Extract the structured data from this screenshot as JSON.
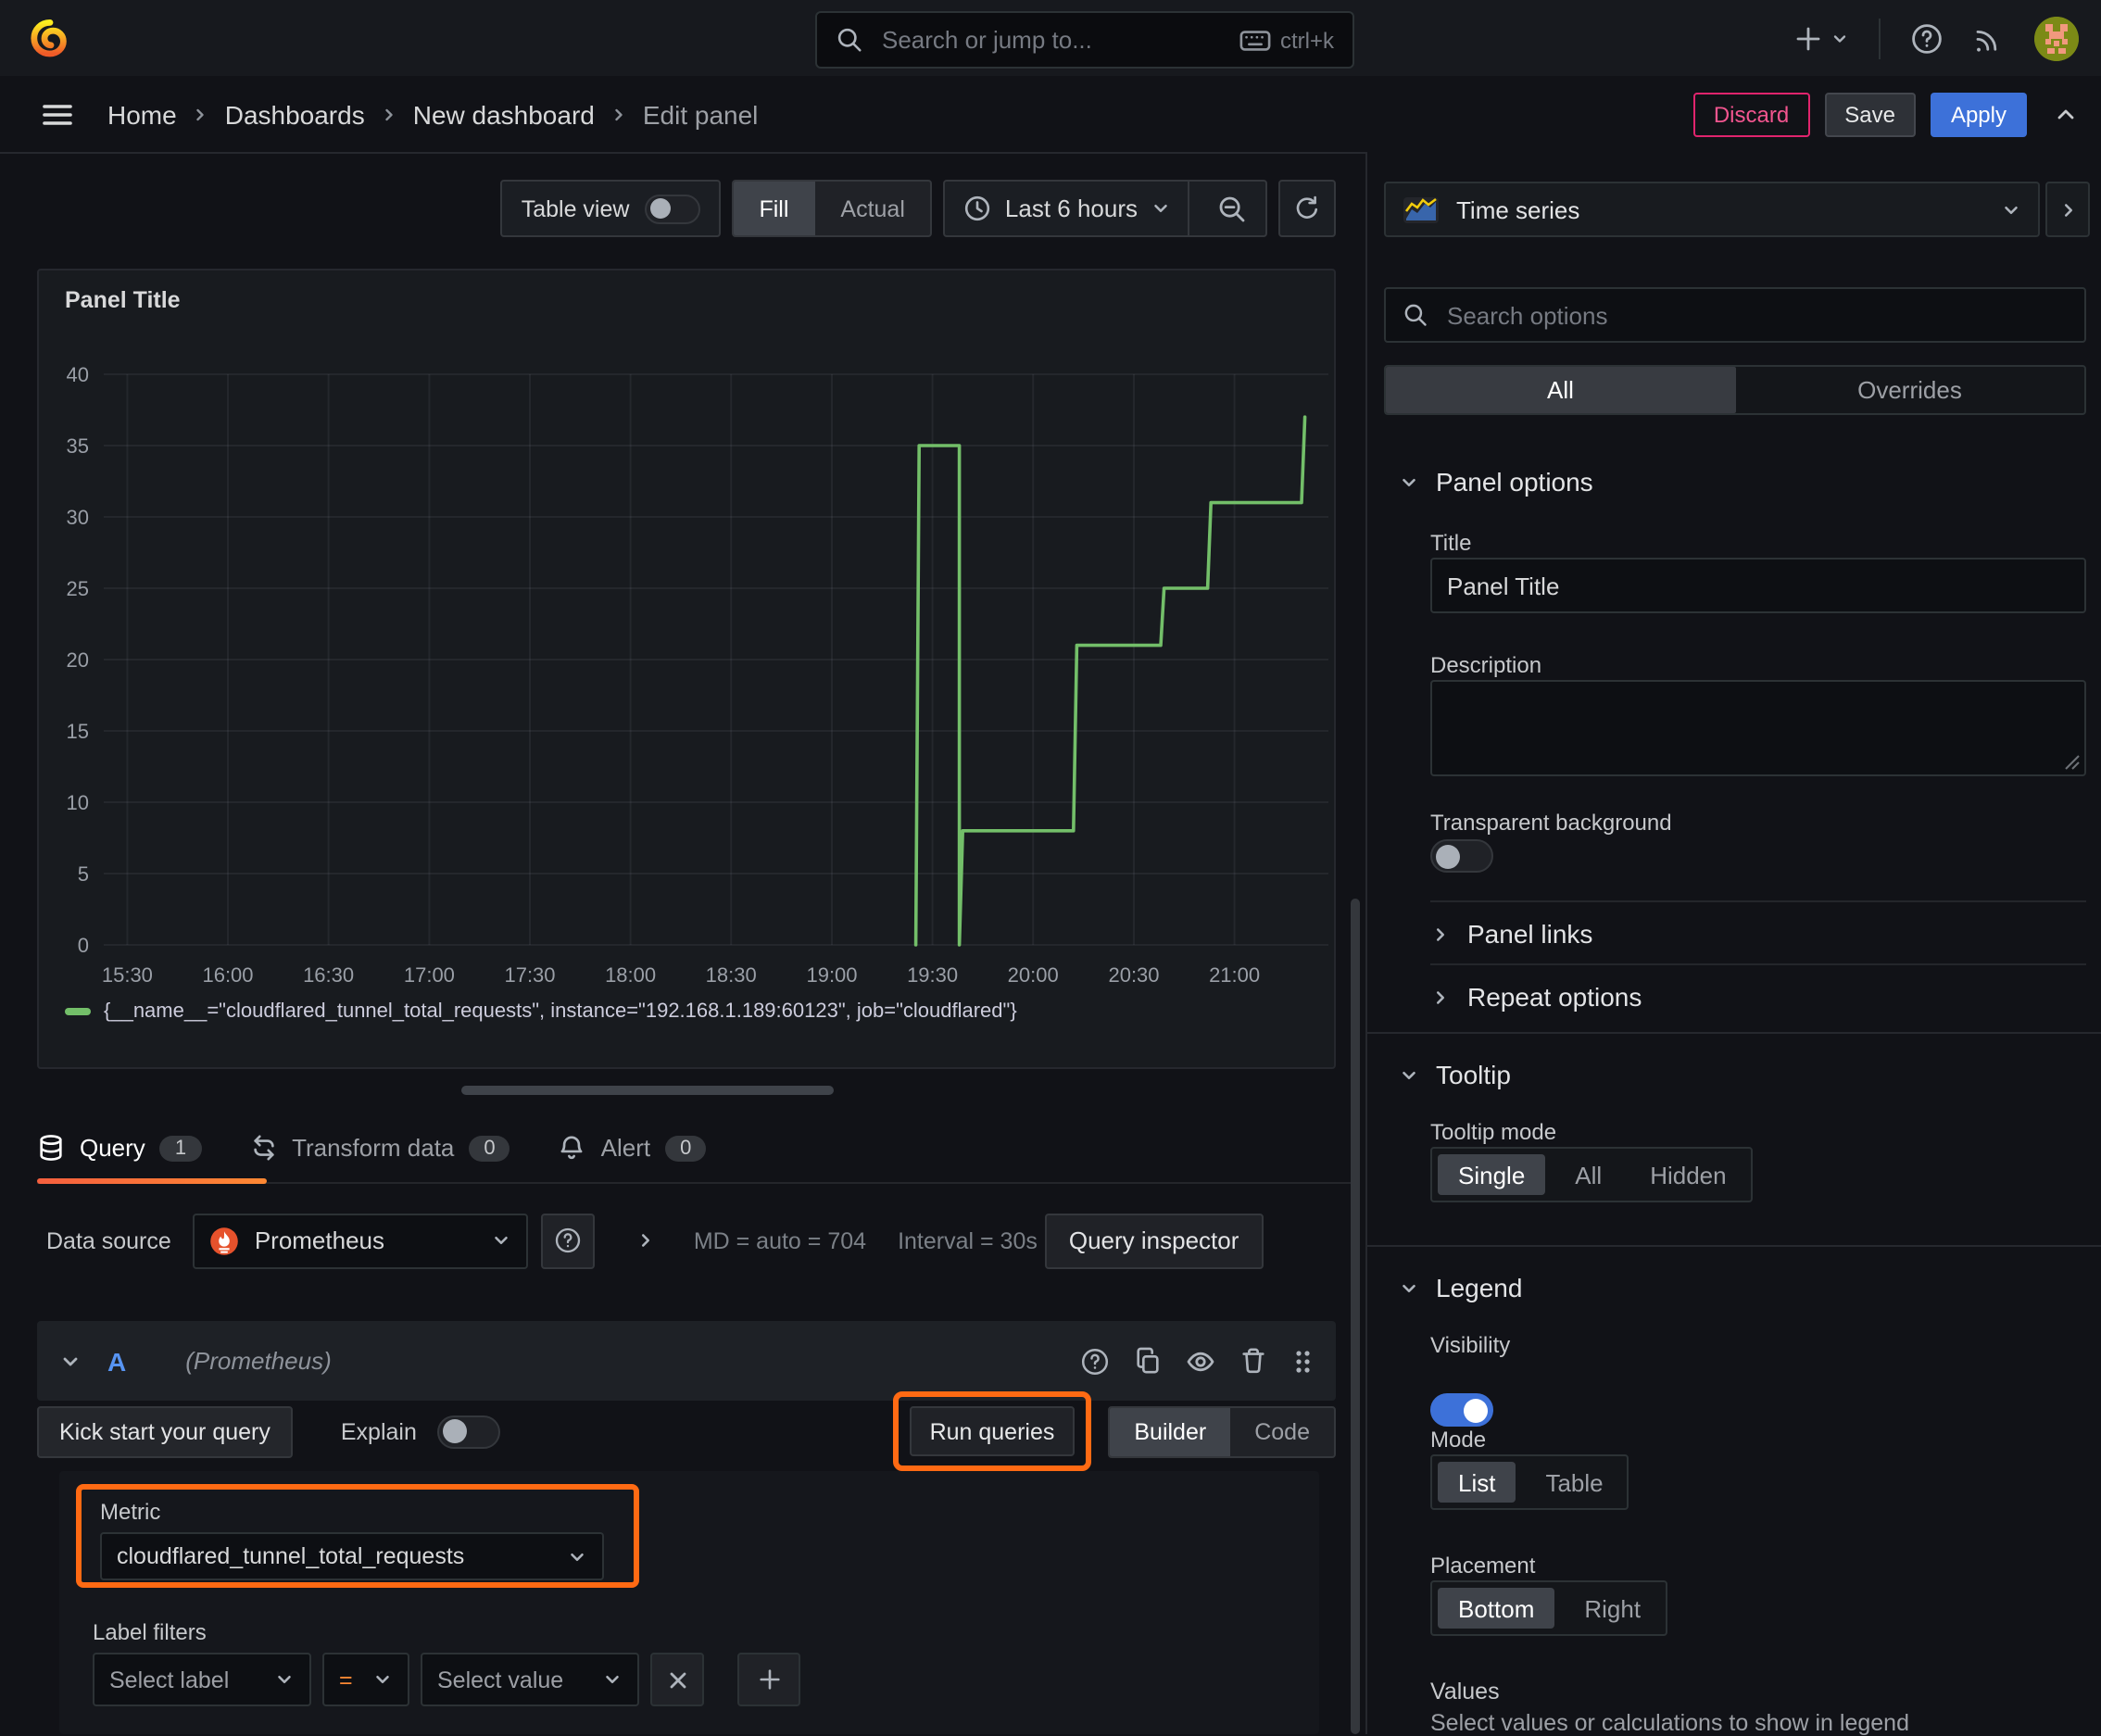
{
  "topnav": {
    "search_placeholder": "Search or jump to...",
    "search_shortcut": "ctrl+k"
  },
  "breadcrumbs": [
    "Home",
    "Dashboards",
    "New dashboard",
    "Edit panel"
  ],
  "actions": {
    "discard": "Discard",
    "save": "Save",
    "apply": "Apply"
  },
  "panel_toolbar": {
    "table_view_label": "Table view",
    "fill_label": "Fill",
    "actual_label": "Actual",
    "time_range_label": "Last 6 hours"
  },
  "panel": {
    "title": "Panel Title"
  },
  "chart_data": {
    "type": "line",
    "title": "Panel Title",
    "xlabel": "",
    "ylabel": "",
    "x_ticks": [
      "15:30",
      "16:00",
      "16:30",
      "17:00",
      "17:30",
      "18:00",
      "18:30",
      "19:00",
      "19:30",
      "20:00",
      "20:30",
      "21:00"
    ],
    "x_range": [
      "15:23",
      "21:28"
    ],
    "y_ticks": [
      0,
      5,
      10,
      15,
      20,
      25,
      30,
      35,
      40
    ],
    "ylim": [
      0,
      40
    ],
    "grid": true,
    "legend_position": "bottom",
    "series": [
      {
        "name": "{__name__=\"cloudflared_tunnel_total_requests\", instance=\"192.168.1.189:60123\", job=\"cloudflared\"}",
        "color": "#73BF69",
        "points": [
          [
            "19:25",
            0
          ],
          [
            "19:26",
            35
          ],
          [
            "19:38",
            35
          ],
          [
            "19:38",
            0
          ],
          [
            "19:39",
            8
          ],
          [
            "20:12",
            8
          ],
          [
            "20:13",
            21
          ],
          [
            "20:38",
            21
          ],
          [
            "20:39",
            25
          ],
          [
            "20:52",
            25
          ],
          [
            "20:53",
            31
          ],
          [
            "21:20",
            31
          ],
          [
            "21:21",
            37
          ]
        ]
      }
    ]
  },
  "query_section": {
    "tabs": [
      {
        "label": "Query",
        "count": "1"
      },
      {
        "label": "Transform data",
        "count": "0"
      },
      {
        "label": "Alert",
        "count": "0"
      }
    ],
    "datasource_label": "Data source",
    "datasource_value": "Prometheus",
    "stats_md": "MD = auto = 704",
    "stats_interval": "Interval = 30s",
    "query_inspector_label": "Query inspector",
    "row": {
      "ref_id": "A",
      "ds_note": "(Prometheus)"
    },
    "kick_start_label": "Kick start your query",
    "explain_label": "Explain",
    "run_queries_label": "Run queries",
    "builder_label": "Builder",
    "code_label": "Code",
    "metric_label": "Metric",
    "metric_value": "cloudflared_tunnel_total_requests",
    "label_filters_label": "Label filters",
    "select_label_placeholder": "Select label",
    "operator_value": "=",
    "select_value_placeholder": "Select value"
  },
  "sidebar": {
    "viz_type": "Time series",
    "search_placeholder": "Search options",
    "tab_all": "All",
    "tab_overrides": "Overrides",
    "panel_options": {
      "heading": "Panel options",
      "title_label": "Title",
      "title_value": "Panel Title",
      "description_label": "Description",
      "transparent_label": "Transparent background"
    },
    "panel_links_heading": "Panel links",
    "repeat_options_heading": "Repeat options",
    "tooltip": {
      "heading": "Tooltip",
      "mode_label": "Tooltip mode",
      "options": [
        "Single",
        "All",
        "Hidden"
      ],
      "selected": "Single"
    },
    "legend": {
      "heading": "Legend",
      "visibility_label": "Visibility",
      "mode_label": "Mode",
      "mode_options": [
        "List",
        "Table"
      ],
      "mode_selected": "List",
      "placement_label": "Placement",
      "placement_options": [
        "Bottom",
        "Right"
      ],
      "placement_selected": "Bottom",
      "values_label": "Values",
      "values_hint": "Select values or calculations to show in legend"
    }
  },
  "colors": {
    "accent_orange": "#FF6A13",
    "series_green": "#73BF69",
    "primary_blue": "#3D71D9",
    "destructive_pink": "#E0246D"
  }
}
